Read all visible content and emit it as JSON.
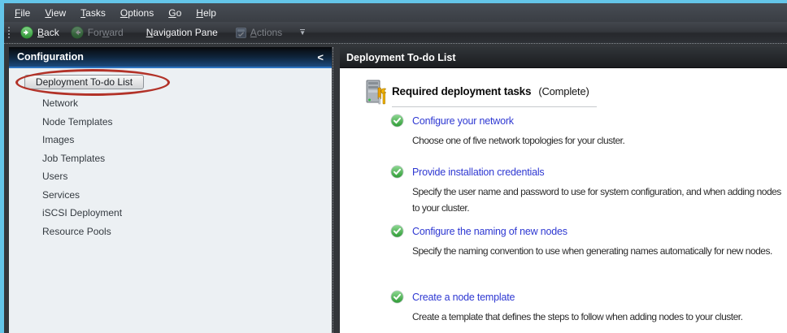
{
  "menubar": {
    "items": [
      {
        "label": "File",
        "key": "F"
      },
      {
        "label": "View",
        "key": "V"
      },
      {
        "label": "Tasks",
        "key": "T"
      },
      {
        "label": "Options",
        "key": "O"
      },
      {
        "label": "Go",
        "key": "G"
      },
      {
        "label": "Help",
        "key": "H"
      }
    ]
  },
  "toolbar": {
    "back": {
      "label": "Back",
      "key": "B",
      "enabled": true
    },
    "forward": {
      "label": "Forward",
      "key": "w",
      "enabled": false
    },
    "nav_pane": {
      "label": "Navigation Pane",
      "key": "N",
      "enabled": true
    },
    "actions": {
      "label": "Actions",
      "key": "A",
      "enabled": false
    }
  },
  "sidebar": {
    "header": "Configuration",
    "collapse_glyph": "<",
    "selected_item": "Deployment To-do List",
    "items": [
      "Network",
      "Node Templates",
      "Images",
      "Job Templates",
      "Users",
      "Services",
      "iSCSI Deployment",
      "Resource Pools"
    ]
  },
  "main": {
    "header": "Deployment To-do List",
    "section": {
      "title": "Required deployment tasks",
      "status": "(Complete)"
    },
    "tasks": [
      {
        "title": "Configure your network",
        "desc": "Choose one of five network topologies for your cluster."
      },
      {
        "title": "Provide installation credentials",
        "desc": "Specify the user name and password to use for system configuration, and when adding nodes to your cluster."
      },
      {
        "title": "Configure the naming of new nodes",
        "desc": "Specify the naming convention to use when generating names automatically for new nodes."
      },
      {
        "title": "Create a node template",
        "desc": "Create a template that defines the steps to follow when adding nodes to your cluster."
      }
    ]
  },
  "icons": {
    "back": "green-circle-left-arrow-icon",
    "forward": "green-circle-right-arrow-icon",
    "actions": "actions-panel-icon",
    "section": "server-with-tools-icon",
    "task_done": "green-check-circle-icon"
  },
  "colors": {
    "window_border": "#64c5e9",
    "sidebar_header_gradient_bottom": "#1c4a7c",
    "sidebar_body_bg": "#ecf0f3",
    "annotation_red": "#b23228",
    "link_blue": "#2e38d2",
    "task_done_green": "#3fae47"
  }
}
